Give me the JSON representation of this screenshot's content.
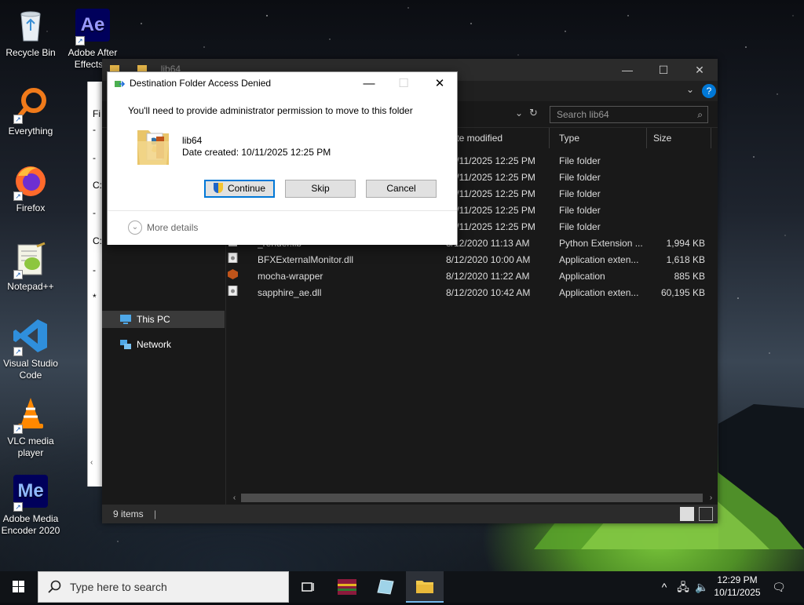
{
  "desktop": {
    "icons": [
      {
        "label": "Recycle Bin"
      },
      {
        "label": "Adobe After Effects 2",
        "glyph": "Ae"
      },
      {
        "label": "Everything"
      },
      {
        "label": "Firefox"
      },
      {
        "label": "Notepad++"
      },
      {
        "label": "Visual Studio Code"
      },
      {
        "label": "VLC media player"
      },
      {
        "label": "Adobe Media Encoder 2020",
        "glyph": "Me"
      }
    ]
  },
  "background_window": {
    "fragments": [
      "Fi",
      "-",
      "-",
      "C:",
      "-",
      "C:",
      "-",
      "*"
    ]
  },
  "explorer": {
    "title_crumb": "lib64",
    "search_placeholder": "Search lib64",
    "columns": {
      "date": "Date modified",
      "type": "Type",
      "size": "Size"
    },
    "nav": {
      "this_pc": "This PC",
      "network": "Network"
    },
    "rows": [
      {
        "name": "",
        "date": "10/11/2025 12:25 PM",
        "type": "File folder",
        "size": ""
      },
      {
        "name": "",
        "date": "10/11/2025 12:25 PM",
        "type": "File folder",
        "size": ""
      },
      {
        "name": "",
        "date": "10/11/2025 12:25 PM",
        "type": "File folder",
        "size": ""
      },
      {
        "name": "",
        "date": "10/11/2025 12:25 PM",
        "type": "File folder",
        "size": ""
      },
      {
        "name": "",
        "date": "10/11/2025 12:25 PM",
        "type": "File folder",
        "size": ""
      },
      {
        "name": "_render.lib",
        "date": "8/12/2020 11:13 AM",
        "type": "Python Extension ...",
        "size": "1,994 KB"
      },
      {
        "name": "BFXExternalMonitor.dll",
        "date": "8/12/2020 10:00 AM",
        "type": "Application exten...",
        "size": "1,618 KB"
      },
      {
        "name": "mocha-wrapper",
        "date": "8/12/2020 11:22 AM",
        "type": "Application",
        "size": "885 KB"
      },
      {
        "name": "sapphire_ae.dll",
        "date": "8/12/2020 10:42 AM",
        "type": "Application exten...",
        "size": "60,195 KB"
      }
    ],
    "status": "9 items"
  },
  "dialog": {
    "title": "Destination Folder Access Denied",
    "message": "You'll need to provide administrator permission to move to this folder",
    "folder_name": "lib64",
    "folder_date": "Date created: 10/11/2025 12:25 PM",
    "buttons": {
      "continue": "Continue",
      "skip": "Skip",
      "cancel": "Cancel"
    },
    "more_details": "More details"
  },
  "taskbar": {
    "search_placeholder": "Type here to search",
    "time": "12:29 PM",
    "date": "10/11/2025"
  },
  "colors": {
    "accent": "#0078d7",
    "explorer_bg": "#191919",
    "taskbar_bg": "#101317"
  }
}
